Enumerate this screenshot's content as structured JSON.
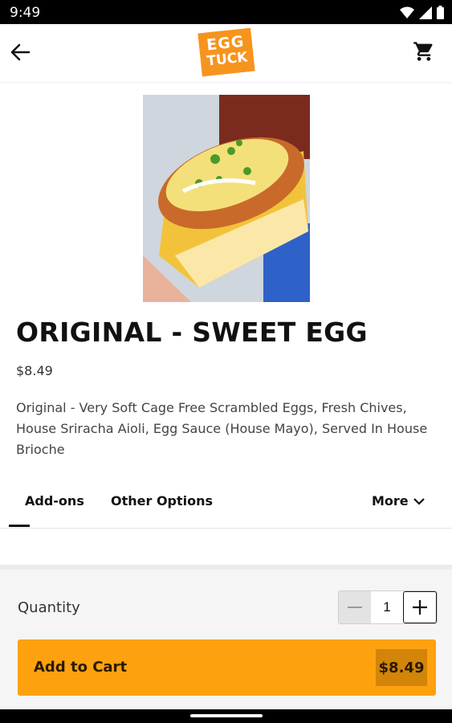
{
  "status_bar": {
    "time": "9:49"
  },
  "brand": {
    "line1": "EGG",
    "line2": "TUCK",
    "color": "#f7941d"
  },
  "item": {
    "title": "ORIGINAL - SWEET EGG",
    "price": "$8.49",
    "description": "Original - Very Soft Cage Free Scrambled Eggs, Fresh Chives, House Sriracha Aioli, Egg Sauce (House Mayo), Served In House Brioche"
  },
  "tabs": [
    {
      "label": "Add-ons",
      "active": true
    },
    {
      "label": "Other Options"
    },
    {
      "label": "More"
    }
  ],
  "footer": {
    "quantity_label": "Quantity",
    "quantity": "1",
    "add_label": "Add to Cart",
    "add_amount": "$8.49"
  },
  "colors": {
    "accent": "#fda10f",
    "accent_dark": "#d28508"
  },
  "icons": [
    "back-arrow-icon",
    "cart-icon",
    "chevron-down-icon",
    "minus-icon",
    "plus-icon",
    "wifi-icon",
    "signal-icon",
    "battery-icon"
  ]
}
